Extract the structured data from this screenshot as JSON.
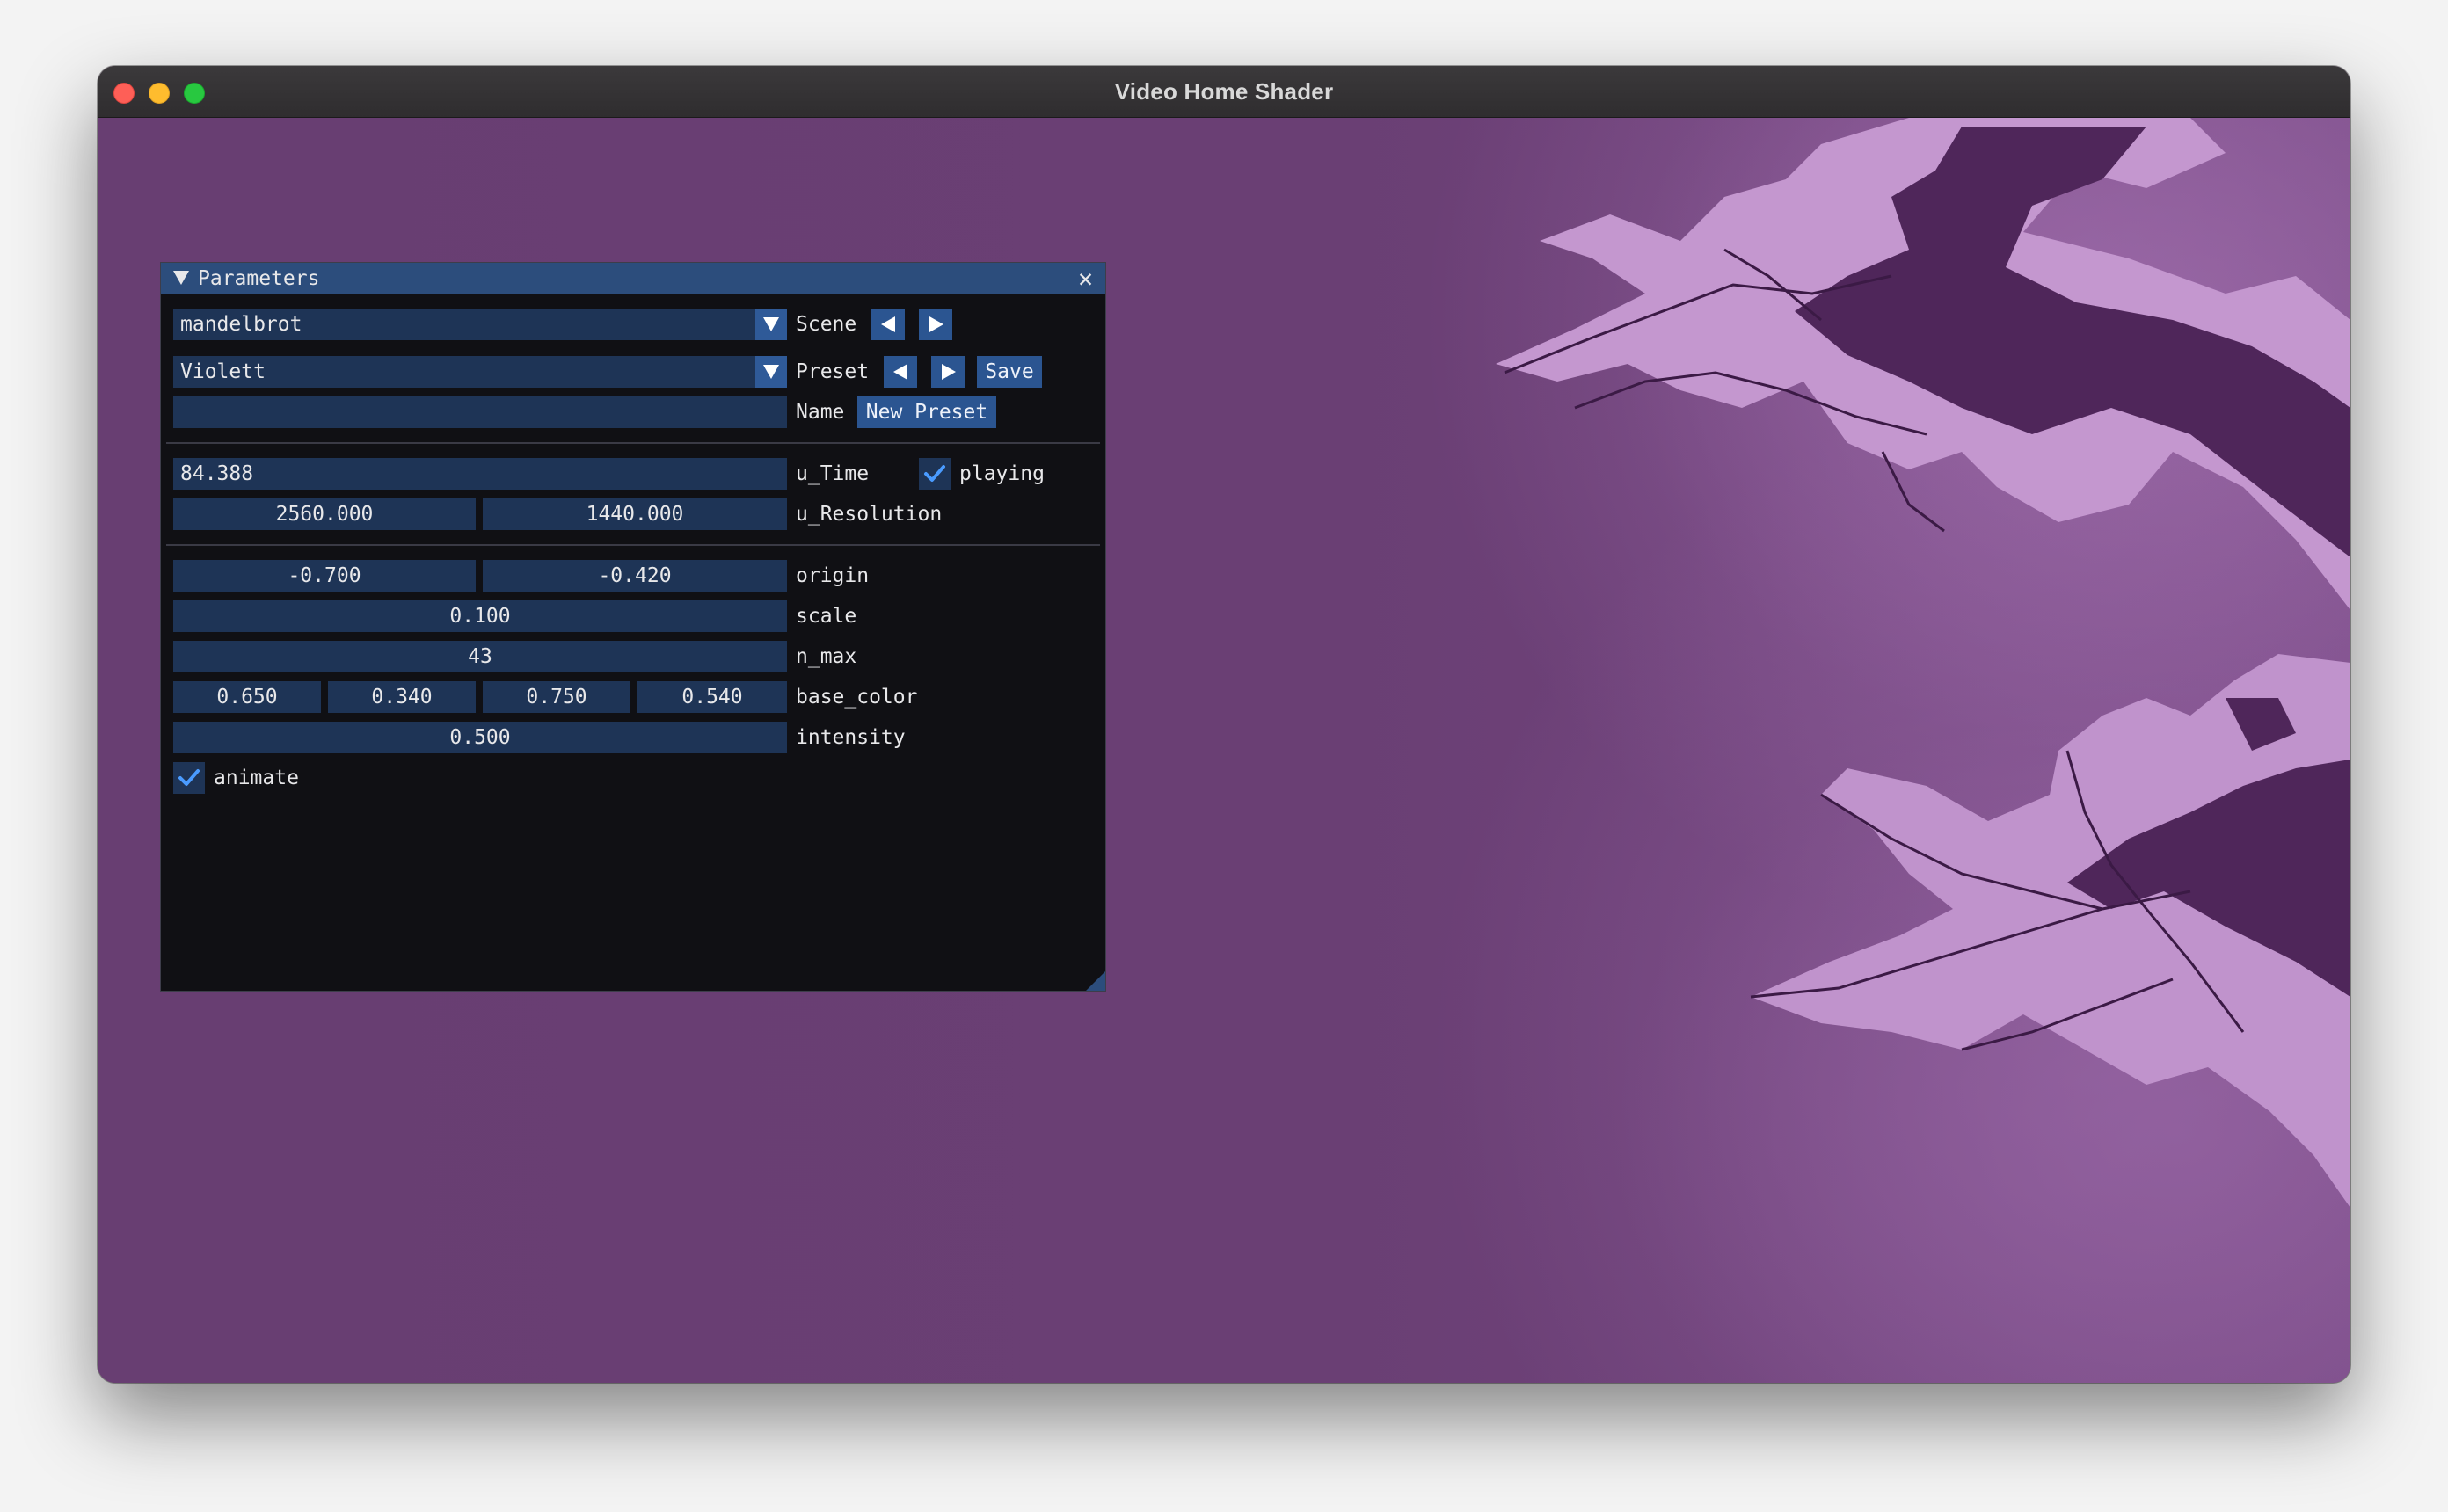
{
  "window": {
    "title": "Video Home Shader"
  },
  "colors": {
    "background": "#683e72",
    "fractal_light": "#c99ad4",
    "fractal_dark": "#4e2759",
    "panel_bg": "#101014",
    "field_bg": "#1e3456",
    "button_bg": "#2b5591",
    "header_bg": "#2c4d7c",
    "check": "#4a9bff"
  },
  "panel": {
    "title": "Parameters",
    "close_icon": "close-icon",
    "scene": {
      "value": "mandelbrot",
      "label": "Scene"
    },
    "preset": {
      "value": "Violett",
      "label": "Preset",
      "save_label": "Save"
    },
    "name": {
      "value": "",
      "label": "Name",
      "new_preset_label": "New Preset"
    },
    "u_time": {
      "value": "84.388",
      "label": "u_Time",
      "playing_label": "playing",
      "playing": true
    },
    "u_resolution": {
      "x": "2560.000",
      "y": "1440.000",
      "label": "u_Resolution"
    },
    "origin": {
      "x": "-0.700",
      "y": "-0.420",
      "label": "origin"
    },
    "scale": {
      "value": "0.100",
      "label": "scale"
    },
    "n_max": {
      "value": "43",
      "label": "n_max"
    },
    "base_color": {
      "r": "0.650",
      "g": "0.340",
      "b": "0.750",
      "a": "0.540",
      "label": "base_color"
    },
    "intensity": {
      "value": "0.500",
      "label": "intensity"
    },
    "animate": {
      "label": "animate",
      "checked": true
    }
  }
}
